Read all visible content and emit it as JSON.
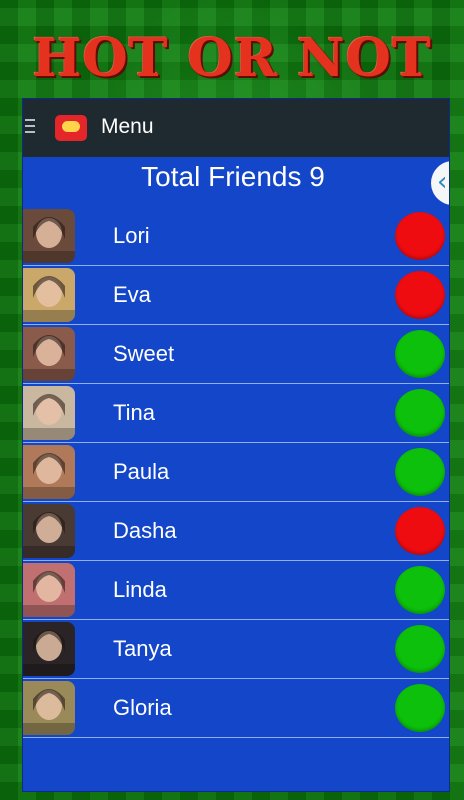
{
  "banner": {
    "title": "HOT OR NOT"
  },
  "actionbar": {
    "menu_label": "Menu"
  },
  "summary": {
    "total_label": "Total Friends 9"
  },
  "drawer": {
    "handle_glyph": "‹"
  },
  "colors": {
    "hot": "#ef0c10",
    "not": "#0cc00c"
  },
  "friends": [
    {
      "name": "Lori",
      "status": "hot",
      "avatar_tone": "#6a4a3a"
    },
    {
      "name": "Eva",
      "status": "hot",
      "avatar_tone": "#c9a86a"
    },
    {
      "name": "Sweet",
      "status": "not",
      "avatar_tone": "#8a5a4a"
    },
    {
      "name": "Tina",
      "status": "not",
      "avatar_tone": "#c9b79f"
    },
    {
      "name": "Paula",
      "status": "not",
      "avatar_tone": "#b07a5a"
    },
    {
      "name": "Dasha",
      "status": "hot",
      "avatar_tone": "#4a3a34"
    },
    {
      "name": "Linda",
      "status": "not",
      "avatar_tone": "#c07070"
    },
    {
      "name": "Tanya",
      "status": "not",
      "avatar_tone": "#2a2426"
    },
    {
      "name": "Gloria",
      "status": "not",
      "avatar_tone": "#9a8a5a"
    }
  ]
}
